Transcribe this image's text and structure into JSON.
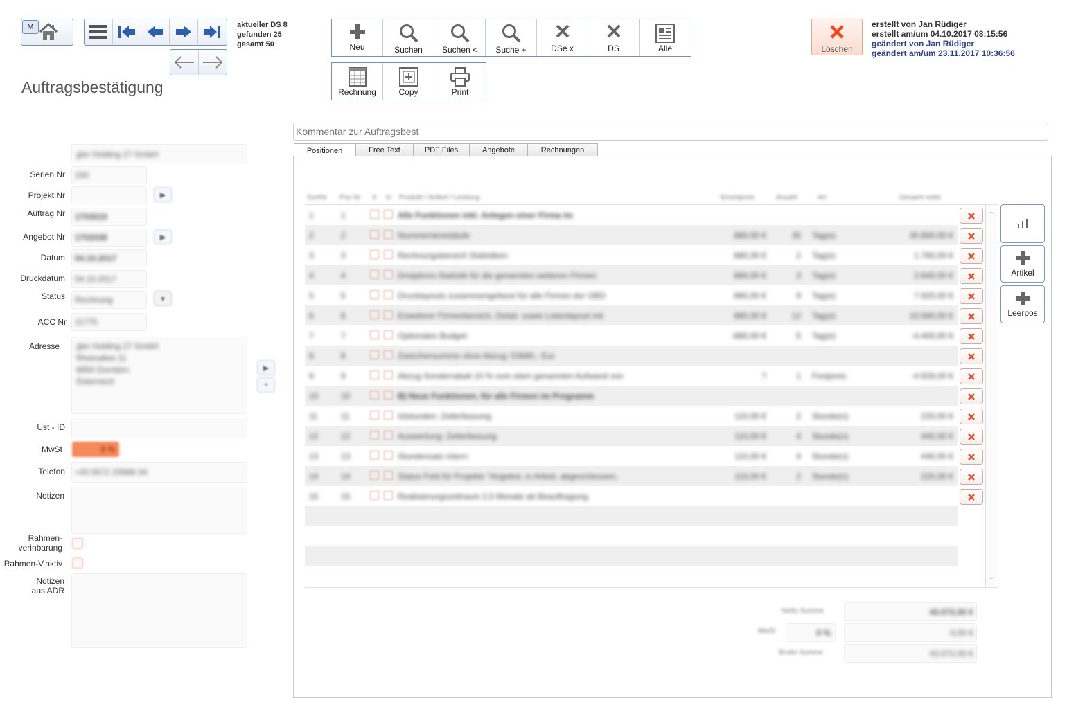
{
  "nav": {
    "m_label": "M",
    "status": {
      "current": "aktueller DS 8",
      "found": "gefunden 25",
      "total": "gesamt 50"
    }
  },
  "page_title": "Auftragsbestätigung",
  "toolbar_main": [
    {
      "label": "Neu",
      "icon": "plus-icon"
    },
    {
      "label": "Suchen",
      "icon": "search-icon"
    },
    {
      "label": "Suchen <",
      "icon": "search-icon"
    },
    {
      "label": "Suche +",
      "icon": "search-icon"
    },
    {
      "label": "DSe x",
      "icon": "close-icon"
    },
    {
      "label": "DS",
      "icon": "close-icon"
    },
    {
      "label": "Alle",
      "icon": "list-icon"
    }
  ],
  "toolbar_secondary": [
    {
      "label": "Rechnung",
      "icon": "invoice-icon"
    },
    {
      "label": "Copy",
      "icon": "copy-icon"
    },
    {
      "label": "Print",
      "icon": "print-icon"
    }
  ],
  "delete_button": {
    "label": "Löschen"
  },
  "record_meta": {
    "created_by": "erstellt von Jan Rüdiger",
    "created_at": "erstellt am/um 04.10.2017 08:15:56",
    "changed_by": "geändert von Jan Rüdiger",
    "changed_at": "geändert am/um 23.11.2017 10:36:56"
  },
  "form": {
    "company_value": "gler Holding 27 GmbH",
    "labels": {
      "serien_nr": "Serien Nr",
      "projekt_nr": "Projekt Nr",
      "auftrag_nr": "Auftrag Nr",
      "angebot_nr": "Angebot Nr",
      "datum": "Datum",
      "druckdatum": "Druckdatum",
      "status": "Status",
      "acc_nr": "ACC Nr",
      "adresse": "Adresse",
      "ust_id": "Ust - ID",
      "mwst": "MwSt",
      "telefon": "Telefon",
      "notizen": "Notizen",
      "rahmen_line1": "Rahmen-",
      "rahmen_line2": "verinbarung",
      "rahmen_aktiv": "Rahmen-V.aktiv",
      "notizen_adr_line1": "Notizen",
      "notizen_adr_line2": "aus ADR"
    },
    "values": {
      "serien_nr": "150",
      "auftrag_nr": "1703019",
      "angebot_nr": "1702038",
      "datum": "04.10.2017",
      "druckdatum": "04.10.2017",
      "status": "Rechnung",
      "acc_nr": "11775",
      "address_lines": [
        "gler Holding 27 GmbH",
        "Rheinallee 11",
        "6850 Dornbirn",
        "Österreich"
      ],
      "mwst": "0 %",
      "telefon": "+43 5572 23568-34"
    }
  },
  "comment_placeholder": "Kommentar zur Auftragsbest",
  "tabs": [
    "Positionen",
    "Free Text",
    "PDF Files",
    "Angebote",
    "Rechnungen"
  ],
  "table": {
    "headers": [
      "SortNr",
      "Pos Nr",
      "X",
      "O",
      "Produkt / Artikel / Leistung",
      "Einzelpreis",
      "Anzahl",
      "Art",
      "Gesamt netto"
    ],
    "rows": [
      {
        "sort": "1",
        "pos": "1",
        "desc": "Alle Funktionen inkl. Anlegen einer Firma im",
        "price": "",
        "qty": "",
        "unit": "",
        "total": "",
        "bold": true
      },
      {
        "sort": "2",
        "pos": "2",
        "desc": "Nummernkreisläufe",
        "price": "880,00 €",
        "qty": "35",
        "unit": "Tag(e)",
        "total": "30.800,00 €",
        "bold": false
      },
      {
        "sort": "3",
        "pos": "3",
        "desc": "Rechnungsbereich Statistiken",
        "price": "880,00 €",
        "qty": "2",
        "unit": "Tag(e)",
        "total": "1.760,00 €",
        "bold": false
      },
      {
        "sort": "4",
        "pos": "4",
        "desc": "Dreijahres-Statistik für die genannten weiteren Firmen",
        "price": "880,00 €",
        "qty": "3",
        "unit": "Tag(e)",
        "total": "2.640,00 €",
        "bold": false
      },
      {
        "sort": "5",
        "pos": "5",
        "desc": "Drucklayouts zusammengefasst für alle Firmen der GBD",
        "price": "880,00 €",
        "qty": "9",
        "unit": "Tag(e)",
        "total": "7.920,00 €",
        "bold": false
      },
      {
        "sort": "6",
        "pos": "6",
        "desc": "Erweiterer Firmenbereich, Detail- sowie Listenlayout mit",
        "price": "880,00 €",
        "qty": "12",
        "unit": "Tag(e)",
        "total": "10.560,00 €",
        "bold": false
      },
      {
        "sort": "7",
        "pos": "7",
        "desc": "Optionales Budget:",
        "price": "-880,00 €",
        "qty": "5",
        "unit": "Tag(e)",
        "total": "-4.400,00 €",
        "bold": false
      },
      {
        "sort": "8",
        "pos": "8",
        "desc": "Zwischensumme ohne Abzug: 53680,- Eur.",
        "price": "",
        "qty": "",
        "unit": "",
        "total": "",
        "bold": false
      },
      {
        "sort": "9",
        "pos": "9",
        "desc": "Abzug Sonderrabatt 10 % vom oben genannten Aufwand von",
        "price": "?",
        "qty": "1",
        "unit": "Festpreis",
        "total": "-4.928,00 €",
        "bold": false
      },
      {
        "sort": "10",
        "pos": "10",
        "desc": "B) Neue Funktionen, für alle Firmen im Programm",
        "price": "",
        "qty": "",
        "unit": "",
        "total": "",
        "bold": true
      },
      {
        "sort": "11",
        "pos": "11",
        "desc": "Iststunden: Zeiterfassung",
        "price": "110,00 €",
        "qty": "2",
        "unit": "Stunde(n)",
        "total": "220,00 €",
        "bold": false
      },
      {
        "sort": "12",
        "pos": "12",
        "desc": "Auswertung: Zeiterfassung",
        "price": "110,00 €",
        "qty": "4",
        "unit": "Stunde(n)",
        "total": "440,00 €",
        "bold": false
      },
      {
        "sort": "13",
        "pos": "13",
        "desc": "Stundensatz intern:",
        "price": "110,00 €",
        "qty": "4",
        "unit": "Stunde(n)",
        "total": "440,00 €",
        "bold": false
      },
      {
        "sort": "14",
        "pos": "14",
        "desc": "Status Feld für Projekte \"Angebot, in Arbeit, abgeschlossen,",
        "price": "110,00 €",
        "qty": "2",
        "unit": "Stunde(n)",
        "total": "220,00 €",
        "bold": false
      },
      {
        "sort": "15",
        "pos": "15",
        "desc": "Realisierungszeitraum 2,5 Monate ab Beauftragung.",
        "price": "",
        "qty": "",
        "unit": "",
        "total": "",
        "bold": false
      }
    ]
  },
  "side_buttons": [
    {
      "label": "",
      "icon": "chart-icon"
    },
    {
      "label": "Artikel",
      "icon": "plus-icon"
    },
    {
      "label": "Leerpos",
      "icon": "plus-icon"
    }
  ],
  "totals": {
    "netto_label": "Netto Summe",
    "netto_value": "43.072,00 €",
    "mwst_label": "MwSt",
    "mwst_rate": "0 %",
    "mwst_value": "0,00 €",
    "brutto_label": "Brutto Summe",
    "brutto_value": "43.072,00 €"
  },
  "colors": {
    "accent_blue": "#3a63b0",
    "delete_red": "#e8502b",
    "mwst_orange": "#f58a5a"
  }
}
